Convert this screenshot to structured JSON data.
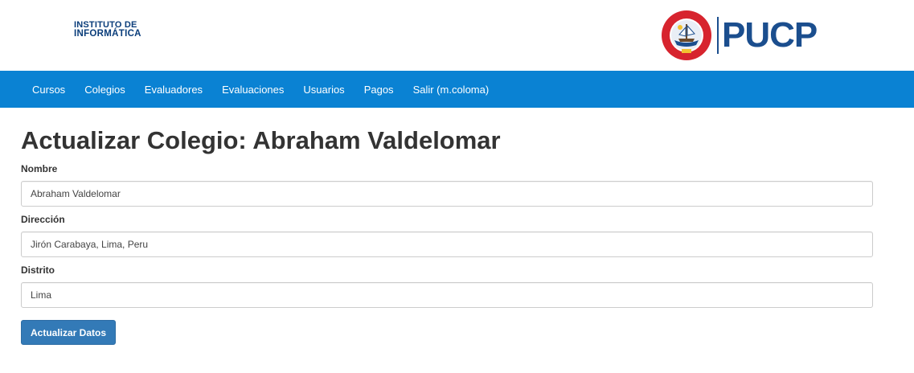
{
  "header": {
    "institute_line1": "INSTITUTO DE",
    "institute_line2": "INFORMÁTICA",
    "university_wordmark": "PUCP",
    "seal_icon": "pucp-seal-icon",
    "seal_motto": "ET LUX IN TENEBRIS LUCET"
  },
  "nav": {
    "items": [
      {
        "label": "Cursos"
      },
      {
        "label": "Colegios"
      },
      {
        "label": "Evaluadores"
      },
      {
        "label": "Evaluaciones"
      },
      {
        "label": "Usuarios"
      },
      {
        "label": "Pagos"
      },
      {
        "label": "Salir (m.coloma)"
      }
    ]
  },
  "page": {
    "title": "Actualizar Colegio: Abraham Valdelomar"
  },
  "form": {
    "nombre_label": "Nombre",
    "nombre_value": "Abraham Valdelomar",
    "direccion_label": "Dirección",
    "direccion_value": "Jirón Carabaya, Lima, Peru",
    "distrito_label": "Distrito",
    "distrito_value": "Lima",
    "submit_label": "Actualizar Datos"
  },
  "colors": {
    "navbar": "#0a82d3",
    "brand_blue": "#1b4e8e",
    "button": "#337ab7",
    "seal_red": "#d7242e"
  }
}
